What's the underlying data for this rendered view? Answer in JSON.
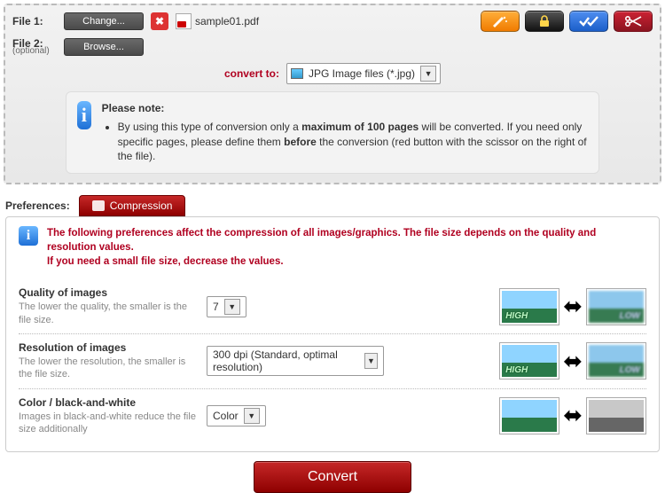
{
  "files": {
    "file1_label": "File 1:",
    "file2_label": "File 2:",
    "file2_sub": "(optional)",
    "change_btn": "Change...",
    "browse_btn": "Browse...",
    "filename": "sample01.pdf"
  },
  "toolbar": {
    "wand": "magic-wand",
    "lock": "lock",
    "check": "check",
    "scissors": "scissors"
  },
  "convert": {
    "label": "convert to:",
    "option": "JPG Image files (*.jpg)"
  },
  "note": {
    "title": "Please note:",
    "line_prefix": "By using this type of conversion only a ",
    "line_bold1": "maximum of 100 pages",
    "line_mid": " will be converted. If you need only specific pages, please define them ",
    "line_bold2": "before",
    "line_suffix": " the conversion (red button with the scissor on the right of the file)."
  },
  "prefs": {
    "label": "Preferences:",
    "tab": "Compression",
    "note_line1": "The following preferences affect the compression of all images/graphics. The file size depends on the quality and resolution values.",
    "note_line2": "If you need a small file size, decrease the values.",
    "quality": {
      "title": "Quality of images",
      "desc": "The lower the quality, the smaller is the file size.",
      "value": "7"
    },
    "resolution": {
      "title": "Resolution of images",
      "desc": "The lower the resolution, the smaller is the file size.",
      "value": "300 dpi (Standard, optimal resolution)"
    },
    "color": {
      "title": "Color / black-and-white",
      "desc": "Images in black-and-white reduce the file size additionally",
      "value": "Color"
    },
    "labels": {
      "high": "HIGH",
      "low": "LOW"
    }
  },
  "convert_btn": "Convert"
}
